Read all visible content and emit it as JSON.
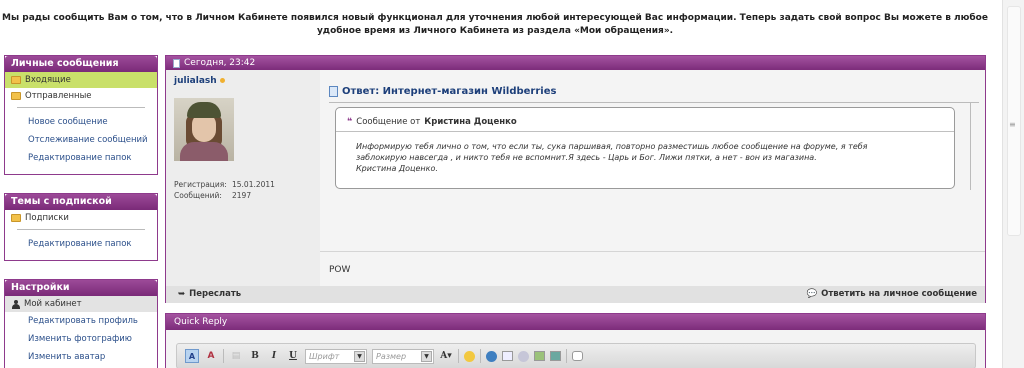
{
  "notice": {
    "line1": "Мы рады сообщить Вам о том, что в Личном Кабинете появился новый функционал для уточнения любой интересующей Вас информации. Теперь задать свой вопрос Вы можете в любое",
    "line2": "удобное время из Личного Кабинета из раздела «Мои обращения»."
  },
  "sidebar": {
    "messages": {
      "title": "Личные сообщения",
      "folders": [
        {
          "label": "Входящие",
          "icon": "folder-icon",
          "active": true
        },
        {
          "label": "Отправленные",
          "icon": "folder-icon"
        }
      ],
      "links": [
        "Новое сообщение",
        "Отслеживание сообщений",
        "Редактирование папок"
      ]
    },
    "subscriptions": {
      "title": "Темы с подпиской",
      "folders": [
        {
          "label": "Подписки",
          "icon": "folder-icon"
        }
      ],
      "links": [
        "Редактирование папок"
      ]
    },
    "settings": {
      "title": "Настройки",
      "selected": {
        "label": "Мой кабинет",
        "icon": "user-icon"
      },
      "links": [
        "Редактировать профиль",
        "Изменить фотографию",
        "Изменить аватар"
      ]
    }
  },
  "post": {
    "date": "Сегодня, 23:42",
    "author": {
      "name": "julialash",
      "reg_label": "Регистрация:",
      "reg_value": "15.01.2011",
      "posts_label": "Сообщений:",
      "posts_value": "2197"
    },
    "title": "Ответ: Интернет-магазин Wildberries",
    "quote": {
      "prefix": "Сообщение от",
      "author": "Кристина Доценко",
      "lines": [
        "Информирую тебя лично о том, что если ты, сука паршивая, повторно разместишь любое сообщение на форуме, я тебя",
        "заблокирую навсегда , и никто тебя не вспомнит.Я здесь - Царь и Бог. Лижи пятки, а нет - вон из магазина.",
        "Кристина Доценко."
      ]
    },
    "body": "POW",
    "forward_label": "Переслать",
    "reply_label": "Ответить на личное сообщение"
  },
  "quick_reply": {
    "title": "Quick Reply",
    "font_placeholder": "Шрифт",
    "size_placeholder": "Размер"
  },
  "colors": {
    "accent": "#8e3a8c",
    "active_folder": "#c9e06a"
  }
}
